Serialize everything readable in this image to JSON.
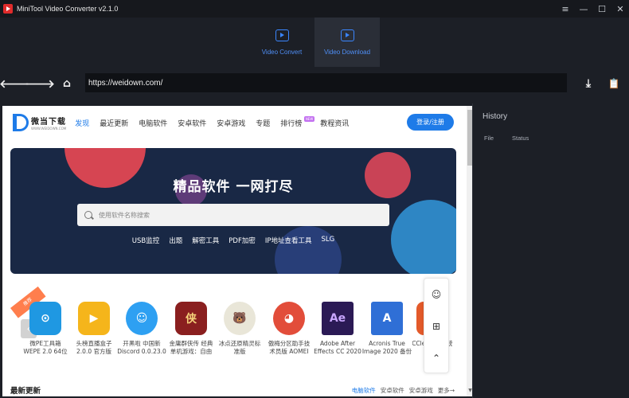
{
  "window": {
    "title": "MiniTool Video Converter v2.1.0",
    "controls": [
      "≡",
      "—",
      "☐",
      "✕"
    ]
  },
  "mode_tabs": [
    {
      "label": "Video Convert",
      "icon": "video-convert-icon",
      "active": false
    },
    {
      "label": "Video Download",
      "icon": "video-download-icon",
      "active": true
    }
  ],
  "nav": {
    "back": "🡐",
    "forward": "🡒",
    "home": "⌂",
    "url": "https://weidown.com/",
    "download": "⤓",
    "clipboard": "📋"
  },
  "site": {
    "logo_cn": "微当下载",
    "logo_en": "WWW.WEIDOWN.COM",
    "nav_items": [
      "发现",
      "最近更新",
      "电脑软件",
      "安卓软件",
      "安卓游戏",
      "专题",
      "排行榜",
      "教程资讯"
    ],
    "new_badge": "NEW",
    "login_label": "登录/注册",
    "hero": {
      "title": "精品软件 一网打尽",
      "search_placeholder": "使用软件名称搜索",
      "tags": [
        "USB监控",
        "出题",
        "解密工具",
        "PDF加密",
        "IP地址查看工具",
        "SLG"
      ]
    },
    "rec_label": "推荐",
    "apps": [
      {
        "name_line1": "微PE工具箱",
        "name_line2": "WEPE 2.0 64位",
        "color": "#1f98e2",
        "glyph": "⊙"
      },
      {
        "name_line1": "头榜直播盒子",
        "name_line2": "2.0.0 官方版",
        "color": "#f5b51b",
        "glyph": "▶"
      },
      {
        "name_line1": "开黑啦 中国新",
        "name_line2": "Discord 0.0.23.0",
        "color": "#2ea0f2",
        "glyph": "☺"
      },
      {
        "name_line1": "金庸群侠传 经典",
        "name_line2": "单机游戏：自由",
        "color": "#8a1f1f",
        "glyph": "侠"
      },
      {
        "name_line1": "冰点还原精灵标",
        "name_line2": "准版",
        "color": "#e9e6d8",
        "glyph": "🐻"
      },
      {
        "name_line1": "傲梅分区助手技",
        "name_line2": "术员版 AOMEI",
        "color": "#e24d3a",
        "glyph": "◕"
      },
      {
        "name_line1": "Adobe After",
        "name_line2": "Effects CC 2020",
        "color": "#2b1a55",
        "glyph": "Ae"
      },
      {
        "name_line1": "Acronis True",
        "name_line2": "Image 2020 备份",
        "color": "#2f6fd6",
        "glyph": "A"
      },
      {
        "name_line1": "CCleaner 系统",
        "name_line2": "",
        "color": "#e35a2a",
        "glyph": "C"
      }
    ],
    "float_buttons": [
      "☺",
      "⊞",
      "⌃"
    ],
    "latest": {
      "title": "最新更新",
      "links": [
        "电脑软件",
        "安卓软件",
        "安卓游戏",
        "更多→"
      ]
    }
  },
  "history": {
    "title": "History",
    "columns": [
      "File",
      "Status"
    ]
  },
  "colors": {
    "accent": "#3a86ff",
    "app_bg": "#1c1f26",
    "site_blue": "#1e7be8",
    "hero_bg": "#192845"
  }
}
